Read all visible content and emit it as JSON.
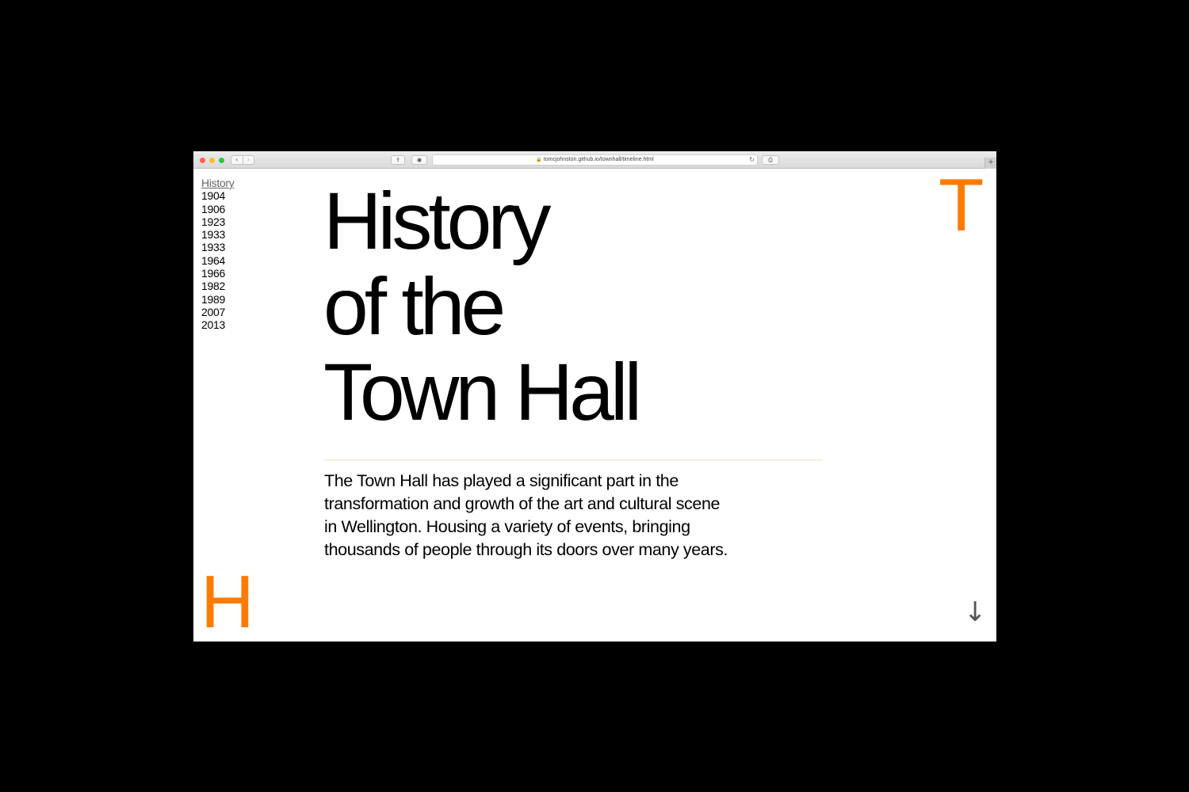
{
  "browser": {
    "url": "tomcjohnston.github.io/townhall/timeline.html",
    "nav_back_icon": "‹",
    "nav_forward_icon": "›",
    "share_icon": "⇪",
    "extension_icon": "◉",
    "lock_icon": "🔒",
    "reload_icon": "↻",
    "print_icon": "⎙",
    "new_tab_icon": "+"
  },
  "sidebar": {
    "items": [
      {
        "label": "History"
      },
      {
        "label": "1904"
      },
      {
        "label": "1906"
      },
      {
        "label": "1923"
      },
      {
        "label": "1933"
      },
      {
        "label": "1933"
      },
      {
        "label": "1964"
      },
      {
        "label": "1966"
      },
      {
        "label": "1982"
      },
      {
        "label": "1989"
      },
      {
        "label": "2007"
      },
      {
        "label": "2013"
      }
    ]
  },
  "hero": {
    "title_line1": "History",
    "title_line2": "of the",
    "title_line3": "Town Hall",
    "intro": "The Town Hall has played a significant part in the transformation and growth of the art and cultural scene in Wellington. Housing a variety of events, bringing thousands of people through its doors over many years."
  },
  "corners": {
    "top_right_letter": "T",
    "bottom_left_letter": "H"
  },
  "scroll_icon": "↓",
  "colors": {
    "accent": "#ff7a00",
    "divider": "#fbeedd",
    "background": "#000000"
  }
}
